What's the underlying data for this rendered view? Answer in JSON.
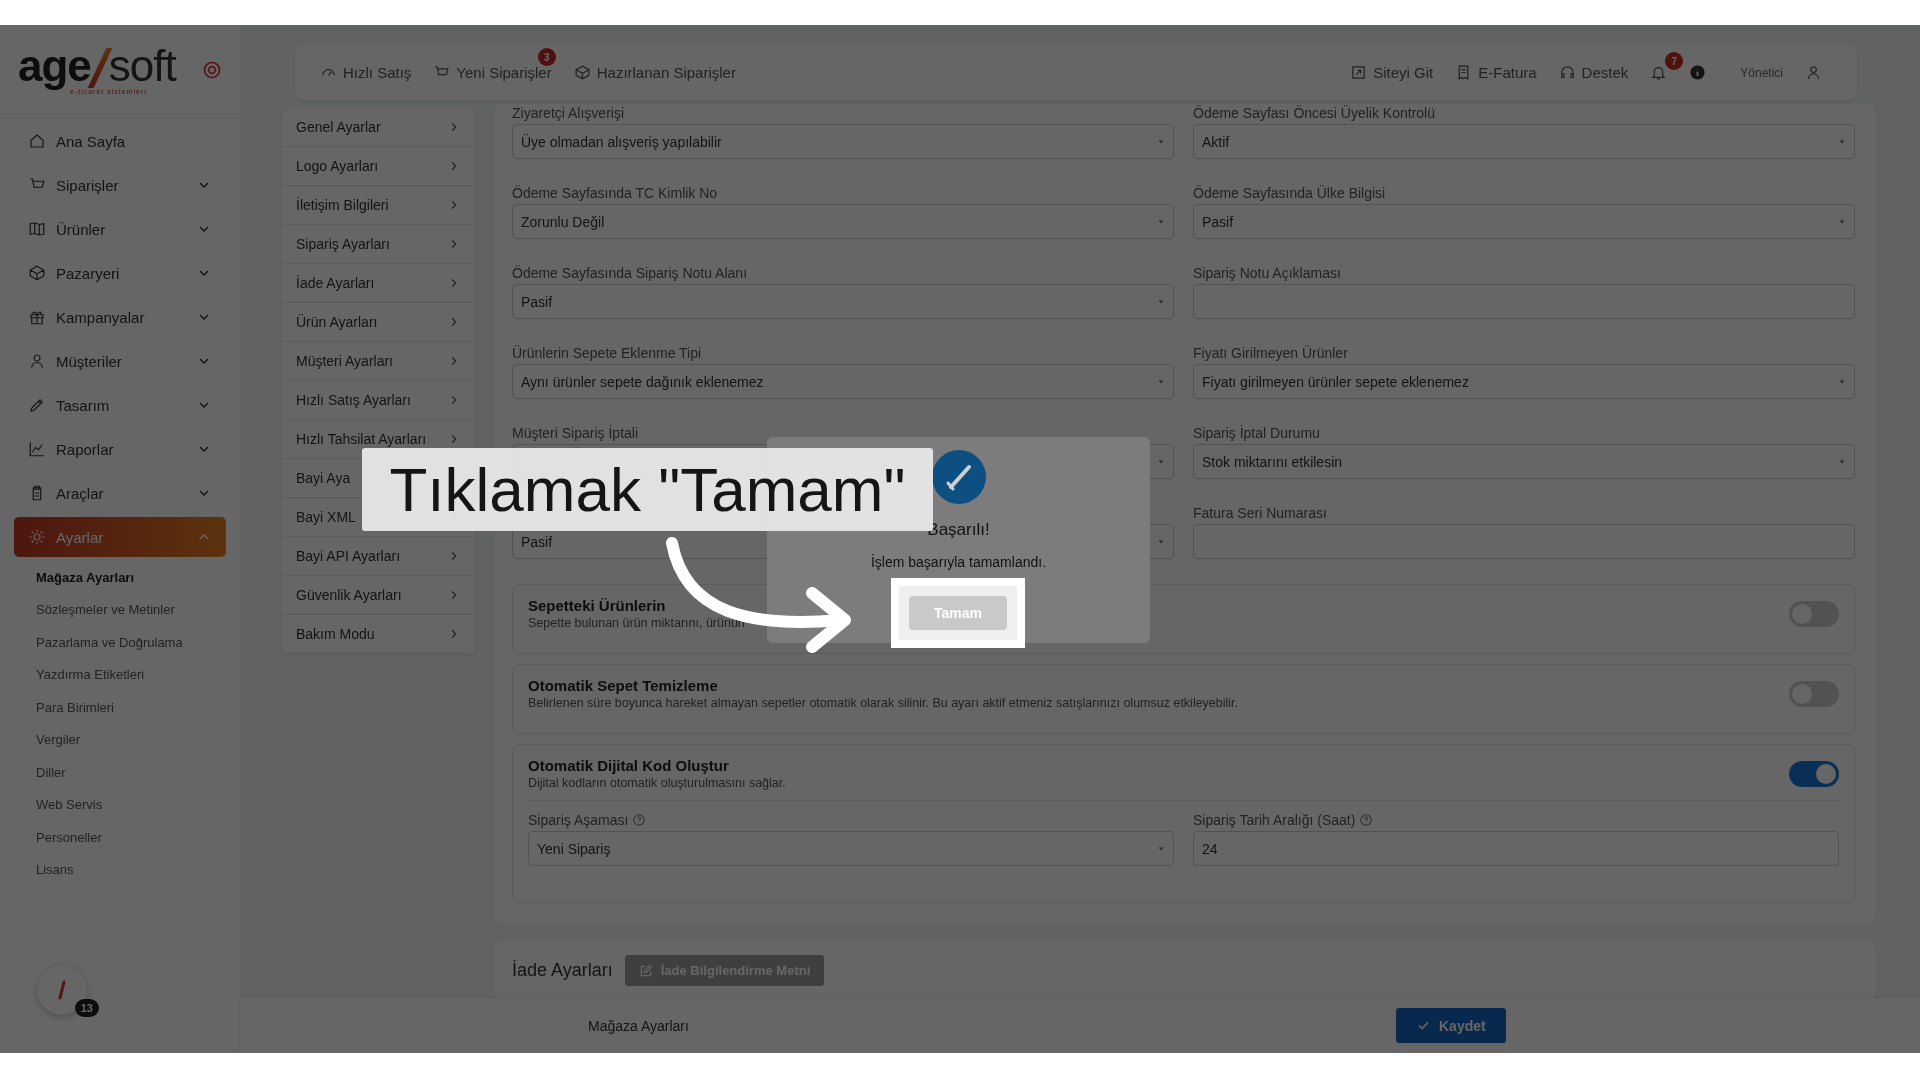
{
  "sidebar": {
    "logo": {
      "part_1": "age",
      "part_2": "soft",
      "tagline": "e-ticaret sistemleri"
    },
    "nav": [
      {
        "label": "Ana Sayfa",
        "expandable": false,
        "selected": false
      },
      {
        "label": "Siparişler",
        "expandable": true,
        "expanded": false,
        "selected": false
      },
      {
        "label": "Ürünler",
        "expandable": true,
        "expanded": false,
        "selected": false
      },
      {
        "label": "Pazaryeri",
        "expandable": true,
        "expanded": false,
        "selected": false
      },
      {
        "label": "Kampanyalar",
        "expandable": true,
        "expanded": false,
        "selected": false
      },
      {
        "label": "Müşteriler",
        "expandable": true,
        "expanded": false,
        "selected": false
      },
      {
        "label": "Tasarım",
        "expandable": true,
        "expanded": false,
        "selected": false
      },
      {
        "label": "Raporlar",
        "expandable": true,
        "expanded": false,
        "selected": false
      },
      {
        "label": "Araçlar",
        "expandable": true,
        "expanded": false,
        "selected": false
      },
      {
        "label": "Ayarlar",
        "expandable": true,
        "expanded": true,
        "selected": true,
        "children": [
          {
            "label": "Mağaza Ayarları",
            "selected": true
          },
          {
            "label": "Sözleşmeler ve Metinler",
            "selected": false
          },
          {
            "label": "Pazarlama ve Doğrulama",
            "selected": false
          },
          {
            "label": "Yazdırma Etiketleri",
            "selected": false
          },
          {
            "label": "Para Birimleri",
            "selected": false
          },
          {
            "label": "Vergiler",
            "selected": false
          },
          {
            "label": "Diller",
            "selected": false
          },
          {
            "label": "Web Servis",
            "selected": false
          },
          {
            "label": "Personeller",
            "selected": false
          },
          {
            "label": "Lisans",
            "selected": false
          }
        ]
      }
    ],
    "floating_button": {
      "badge": "13"
    }
  },
  "header": {
    "left_links": [
      {
        "label": "Hızlı Satış"
      },
      {
        "label": "Yeni Siparişler",
        "badge": "3"
      },
      {
        "label": "Hazırlanan Siparişler"
      }
    ],
    "right_links": [
      {
        "label": "Siteyi Git"
      },
      {
        "label": "E-Fatura"
      },
      {
        "label": "Destek"
      }
    ],
    "notifications_badge": "7",
    "user": "Yönetici"
  },
  "settings_menu": [
    {
      "label": "Genel Ayarlar"
    },
    {
      "label": "Logo Ayarları"
    },
    {
      "label": "İletişim Bilgileri"
    },
    {
      "label": "Sipariş Ayarları"
    },
    {
      "label": "İade Ayarları"
    },
    {
      "label": "Ürün Ayarları"
    },
    {
      "label": "Müşteri Ayarları"
    },
    {
      "label": "Hızlı Satış Ayarları"
    },
    {
      "label": "Hızlı Tahsilat Ayarları"
    },
    {
      "label": "Bayi Aya"
    },
    {
      "label": "Bayi XML"
    },
    {
      "label": "Bayi API Ayarları"
    },
    {
      "label": "Güvenlik Ayarları"
    },
    {
      "label": "Bakım Modu"
    }
  ],
  "form": {
    "rows": [
      {
        "fields": [
          {
            "label": "Ziyaretçi Alışverişi",
            "kind": "select",
            "value": "Üye olmadan alışveriş yapılabilir"
          },
          {
            "label": "Ödeme Sayfası Öncesi Üyelik Kontrolü",
            "kind": "select",
            "value": "Aktif"
          }
        ]
      },
      {
        "fields": [
          {
            "label": "Ödeme Sayfasında TC Kimlik No",
            "kind": "select",
            "value": "Zorunlu Değil"
          },
          {
            "label": "Ödeme Sayfasında Ülke Bilgisi",
            "kind": "select",
            "value": "Pasif"
          }
        ]
      },
      {
        "fields": [
          {
            "label": "Ödeme Sayfasında Sipariş Notu Alanı",
            "kind": "select",
            "value": "Pasif"
          },
          {
            "label": "Sipariş Notu Açıklaması",
            "kind": "text"
          }
        ]
      },
      {
        "fields": [
          {
            "label": "Ürünlerin Sepete Eklenme Tipi",
            "kind": "select",
            "value": "Aynı ürünler sepete dağınık eklenemez"
          },
          {
            "label": "Fiyatı Girilmeyen Ürünler",
            "kind": "select",
            "value": "Fiyatı girilmeyen ürünler sepete eklenemez"
          }
        ]
      },
      {
        "fields": [
          {
            "label": "Müşteri Sipariş İptali",
            "kind": "select"
          },
          {
            "label": "Sipariş İptal Durumu",
            "kind": "select",
            "value": "Stok miktarını etkilesin"
          }
        ]
      },
      {
        "fields": [
          {
            "kind": "select",
            "value": "Pasif"
          },
          {
            "label": "Fatura Seri Numarası",
            "kind": "text"
          }
        ]
      }
    ],
    "toggles": [
      {
        "title": "Sepetteki Ürünlerin",
        "description": "Sepette bulunan ürün miktarını, ürünün",
        "on": false
      },
      {
        "title": "Otomatik Sepet Temizleme",
        "description": "Belirlenen süre boyunca hareket almayan sepetler otomatik olarak silinir. Bu ayarı aktif etmeniz satışlarınızı olumsuz etkileyebilir.",
        "on": false
      },
      {
        "title": "Otomatik Dijital Kod Oluştur",
        "description": "Dijital kodların otomatik oluşturulmasını sağlar.",
        "on": true,
        "fields": [
          {
            "label": "Sipariş Aşaması",
            "help": true,
            "kind": "select",
            "value": "Yeni Sipariş"
          },
          {
            "label": "Sipariş Tarih Aralığı (Saat)",
            "help": true,
            "kind": "text",
            "value": "24"
          }
        ]
      }
    ]
  },
  "return_section": {
    "title": "İade Ayarları",
    "button": "İade Bilgilendirme Metni"
  },
  "footer": {
    "title": "Mağaza Ayarları",
    "save_button": "Kaydet"
  },
  "dialog": {
    "title": "Başarılı!",
    "message": "İşlem başarıyla tamamlandı.",
    "button": "Tamam"
  },
  "tutorial_caption": "Tıklamak \"Tamam\""
}
